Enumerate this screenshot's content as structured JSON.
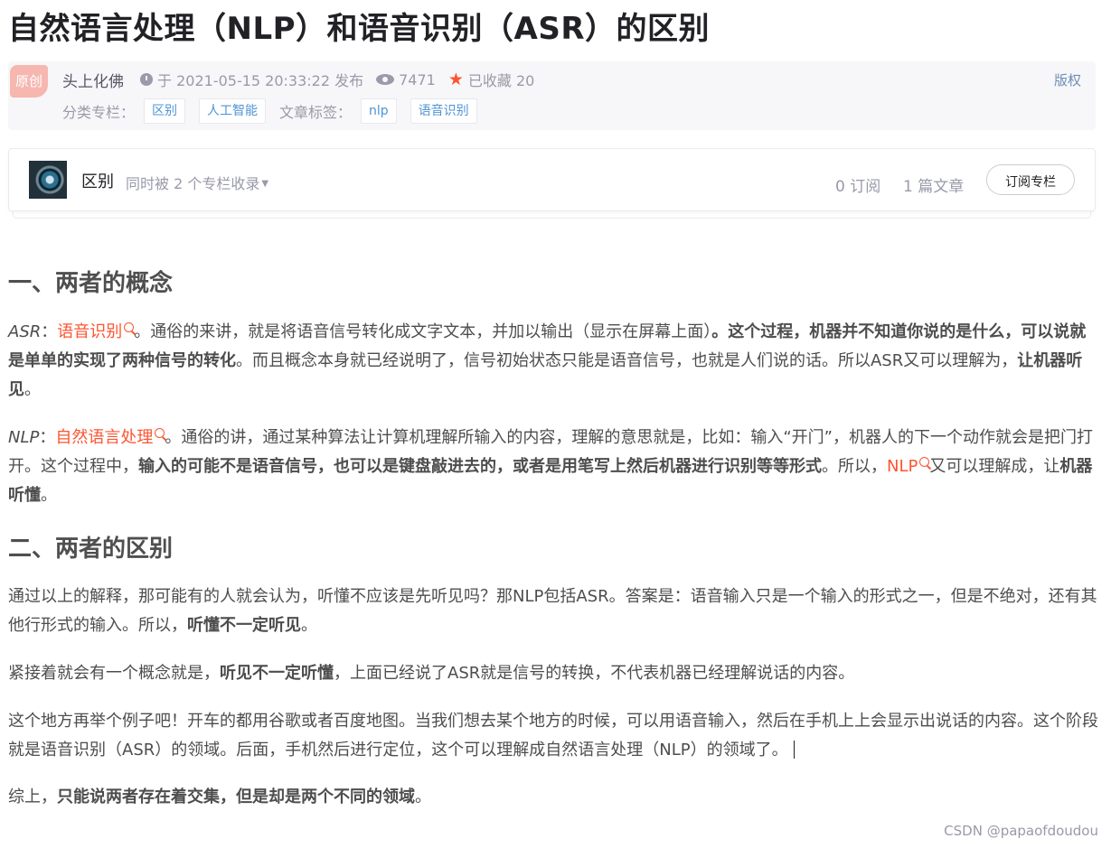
{
  "article": {
    "title": "自然语言处理（NLP）和语音识别（ASR）的区别",
    "badge": "原创",
    "author": "头上化佛",
    "publish": "于 2021-05-15 20:33:22 发布",
    "views": "7471",
    "favorites": "已收藏 20",
    "copyright": "版权",
    "category_label": "分类专栏：",
    "categories": [
      "区别",
      "人工智能"
    ],
    "tags_label": "文章标签：",
    "tags": [
      "nlp",
      "语音识别"
    ]
  },
  "column": {
    "name": "区别",
    "included_in": "同时被 2 个专栏收录",
    "subscribers": "0 订阅",
    "articles": "1 篇文章",
    "subscribe_label": "订阅专栏"
  },
  "content": {
    "h1": "一、两者的概念",
    "p1": {
      "term": "ASR",
      "colon": "：",
      "keyword": "语音识别",
      "t1": "。通俗的来讲，就是将语音信号转化成文字文本，并加以输出（显示在屏幕上面）",
      "b1": "。这个过程，机器并不知道你说的是什么，可以说就是单单的实现了两种信号的转化",
      "t2": "。而且概念本身就已经说明了，信号初始状态只能是语音信号，也就是人们说的话。所以ASR又可以理解为，",
      "b2": "让机器听见",
      "t3": "。"
    },
    "p2": {
      "term": "NLP",
      "colon": "：",
      "keyword": "自然语言处理",
      "t1": "。通俗的讲，通过某种算法让计算机理解所输入的内容，理解的意思就是，比如：输入“开门”，机器人的下一个动作就会是把门打开。这个过程中，",
      "b1": "输入的可能不是语音信号，也可以是键盘敲进去的，或者是用笔写上然后机器进行识别等等形式",
      "t2": "。所以，",
      "keyword2": "NLP",
      "t3": "又可以理解成，让",
      "b2": "机器听懂",
      "t4": "。"
    },
    "h2": "二、两者的区别",
    "p3": {
      "t1": "通过以上的解释，那可能有的人就会认为，听懂不应该是先听见吗？那NLP包括ASR。答案是：语音输入只是一个输入的形式之一，但是不绝对，还有其他行形式的输入。所以，",
      "b1": "听懂不一定听见",
      "t2": "。"
    },
    "p4": {
      "t1": "紧接着就会有一个概念就是，",
      "b1": "听见不一定听懂",
      "t2": "，上面已经说了ASR就是信号的转换，不代表机器已经理解说话的内容。"
    },
    "p5": {
      "t1": "这个地方再举个例子吧！开车的都用谷歌或者百度地图。当我们想去某个地方的时候，可以用语音输入，然后在手机上上会显示出说话的内容。这个阶段就是语音识别（ASR）的领域。后面，手机然后进行定位，这个可以理解成自然语言处理（NLP）的领域了。"
    },
    "p6": {
      "t1": "综上，",
      "b1": "只能说两者存在着交集，但是却是两个不同的领域",
      "t2": "。"
    }
  },
  "watermark": "CSDN @papaofdoudou",
  "colors": {
    "accent": "#fc5531",
    "tag_text": "#5094d5",
    "badge_bg": "#f6b7b1"
  }
}
